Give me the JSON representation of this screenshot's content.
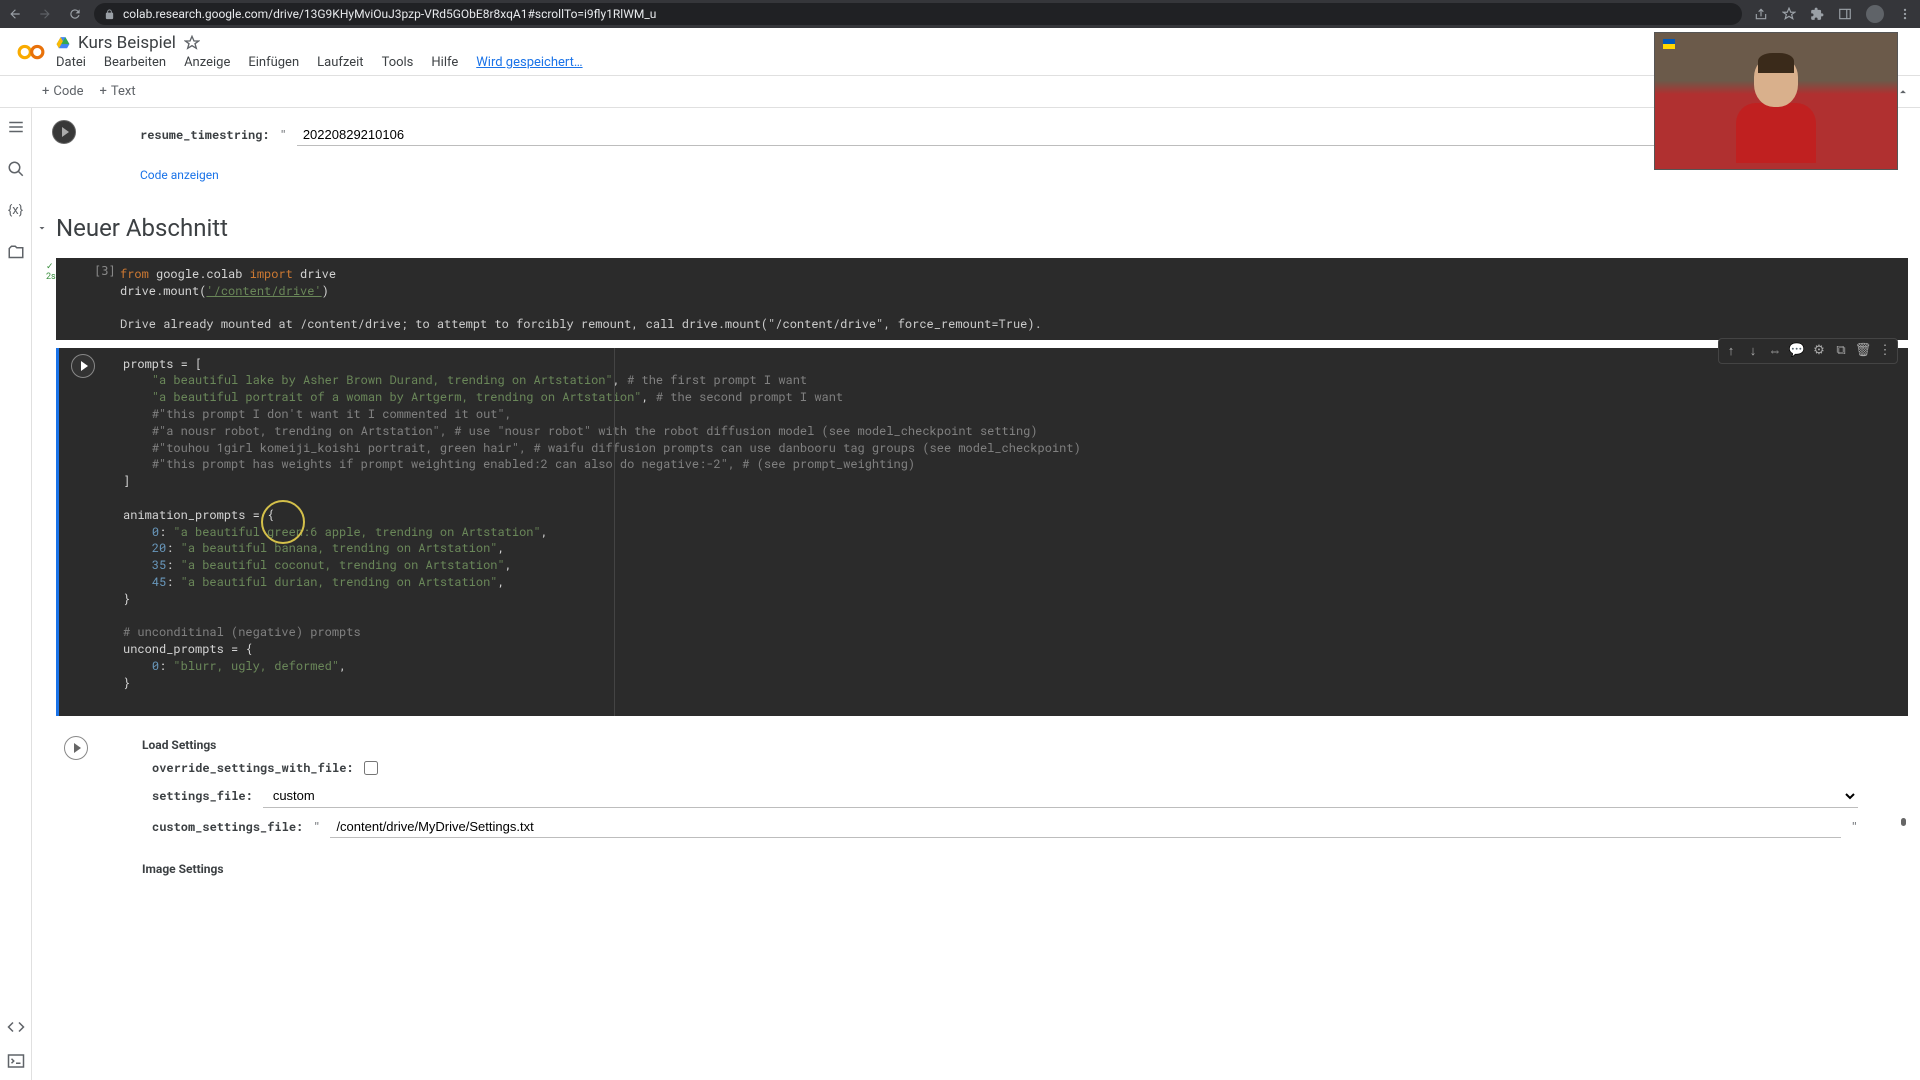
{
  "browser": {
    "url": "colab.research.google.com/drive/13G9KHyMviOuJ3pzp-VRd5GObE8r8xqA1#scrollTo=i9fly1RlWM_u"
  },
  "header": {
    "title": "Kurs Beispiel",
    "menu": {
      "datei": "Datei",
      "bearbeiten": "Bearbeiten",
      "anzeige": "Anzeige",
      "einfugen": "Einfügen",
      "laufzeit": "Laufzeit",
      "tools": "Tools",
      "hilfe": "Hilfe",
      "saving": "Wird gespeichert…"
    }
  },
  "toolbar": {
    "code": "Code",
    "text": "Text"
  },
  "cell0": {
    "label": "resume_timestring:",
    "value": "20220829210106",
    "link": "Code anzeigen"
  },
  "section": {
    "title": "Neuer Abschnitt"
  },
  "cell1": {
    "exec": "[3]",
    "line1_kw1": "from",
    "line1_mod": " google.colab ",
    "line1_kw2": "import",
    "line1_id": " drive",
    "line2a": "drive.mount(",
    "line2_str": "'/content/drive'",
    "line2b": ")",
    "output": "Drive already mounted at /content/drive; to attempt to forcibly remount, call drive.mount(\"/content/drive\", force_remount=True)."
  },
  "cell2": {
    "l1a": "prompts = [",
    "l2s": "\"a beautiful lake by Asher Brown Durand, trending on Artstation\"",
    "l2c": ", ",
    "l2cm": "# the first prompt I want",
    "l3s": "\"a beautiful portrait of a woman by Artgerm, trending on Artstation\"",
    "l3c": ", ",
    "l3cm": "# the second prompt I want",
    "l4": "#\"this prompt I don't want it I commented it out\",",
    "l5": "#\"a nousr robot, trending on Artstation\", # use \"nousr robot\" with the robot diffusion model (see model_checkpoint setting)",
    "l6": "#\"touhou 1girl komeiji_koishi portrait, green hair\", # waifu diffusion prompts can use danbooru tag groups (see model_checkpoint)",
    "l7": "#\"this prompt has weights if prompt weighting enabled:2 can also do negative:-2\", # (see prompt_weighting)",
    "l8": "]",
    "l9": "",
    "l10": "animation_prompts = {",
    "l11n": "0",
    "l11s": "\"a beautiful green:6 apple, trending on Artstation\"",
    "l12n": "20",
    "l12s": "\"a beautiful banana, trending on Artstation\"",
    "l13n": "35",
    "l13s": "\"a beautiful coconut, trending on Artstation\"",
    "l14n": "45",
    "l14s": "\"a beautiful durian, trending on Artstation\"",
    "l15": "}",
    "l16": "",
    "l17": "# unconditinal (negative) prompts",
    "l18": "uncond_prompts = {",
    "l19n": "0",
    "l19s": "\"blurr, ugly, deformed\"",
    "l20": "}"
  },
  "loadSettings": {
    "title": "Load Settings",
    "override_label": "override_settings_with_file:",
    "settings_label": "settings_file:",
    "settings_value": "custom",
    "custom_label": "custom_settings_file:",
    "custom_value": "/content/drive/MyDrive/Settings.txt",
    "image_title": "Image Settings"
  }
}
